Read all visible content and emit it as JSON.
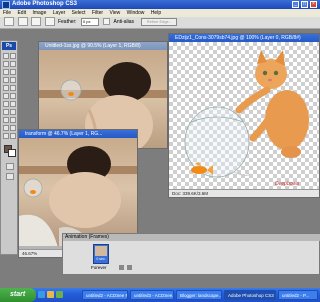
{
  "app": {
    "title": "Adobe Photoshop CS3"
  },
  "menu": [
    "File",
    "Edit",
    "Image",
    "Layer",
    "Select",
    "Filter",
    "View",
    "Window",
    "Help"
  ],
  "options": {
    "feather_label": "Feather:",
    "feather_value": "0 px",
    "antialias_label": "Anti-alias",
    "refine_label": "Refine Edge..."
  },
  "toolbox": {
    "label": "Ps"
  },
  "documents": {
    "doc1": {
      "title": "Untitled-1ss.jpg @ 90.5% (Layer 1, RGB/8)"
    },
    "doc2": {
      "title": "EDzijz1_Cons-3079sb74.jpg @ 100% (Layer 0, RGB/8#)",
      "status": "Doc: 339.6K/3.6M",
      "watermark": "Deepbowa"
    },
    "doc3": {
      "title": "transform @ 46.7% (Layer 1, RG...",
      "zoom": "46.67%"
    }
  },
  "animation": {
    "title": "Animation (Frames)",
    "frame_label": "0 sec.",
    "forever": "Forever"
  },
  "taskbar": {
    "start": "start",
    "items": [
      "untitled2 - ACDSee P...",
      "untitled3 - ACDSee...",
      "Blogger: landscape...",
      "Adobe Photoshop CS3",
      "untitled2 - P..."
    ]
  }
}
